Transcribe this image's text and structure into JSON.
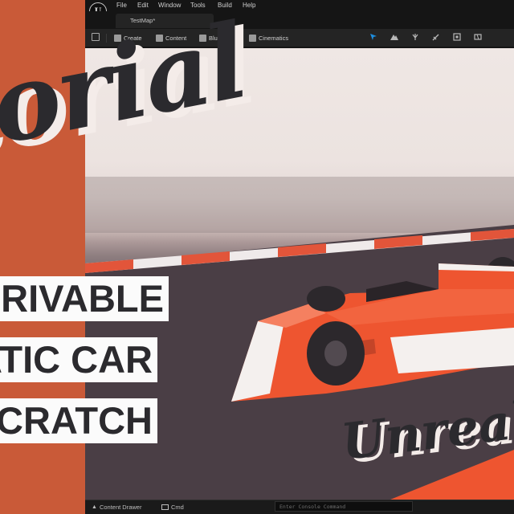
{
  "editor": {
    "menu": [
      "File",
      "Edit",
      "Window",
      "Tools",
      "Build",
      "Help"
    ],
    "map_tab": "TestMap*",
    "logo": "U",
    "toolbar": {
      "create": "Create",
      "content": "Content",
      "blueprints": "Blueprints",
      "cinematics": "Cinematics"
    },
    "statusbar": {
      "content_drawer": "Content Drawer",
      "cmd": "Cmd",
      "console_placeholder": "Enter Console Command"
    }
  },
  "overlay": {
    "title": "torial",
    "captions": [
      "Y DRIVABLE",
      "MATIC CAR",
      "I SCRATCH"
    ],
    "brand": "Unreal E"
  },
  "colors": {
    "accent_orange": "#c95a38",
    "car_red": "#ee5530",
    "title_ink": "#2b2a2e"
  }
}
